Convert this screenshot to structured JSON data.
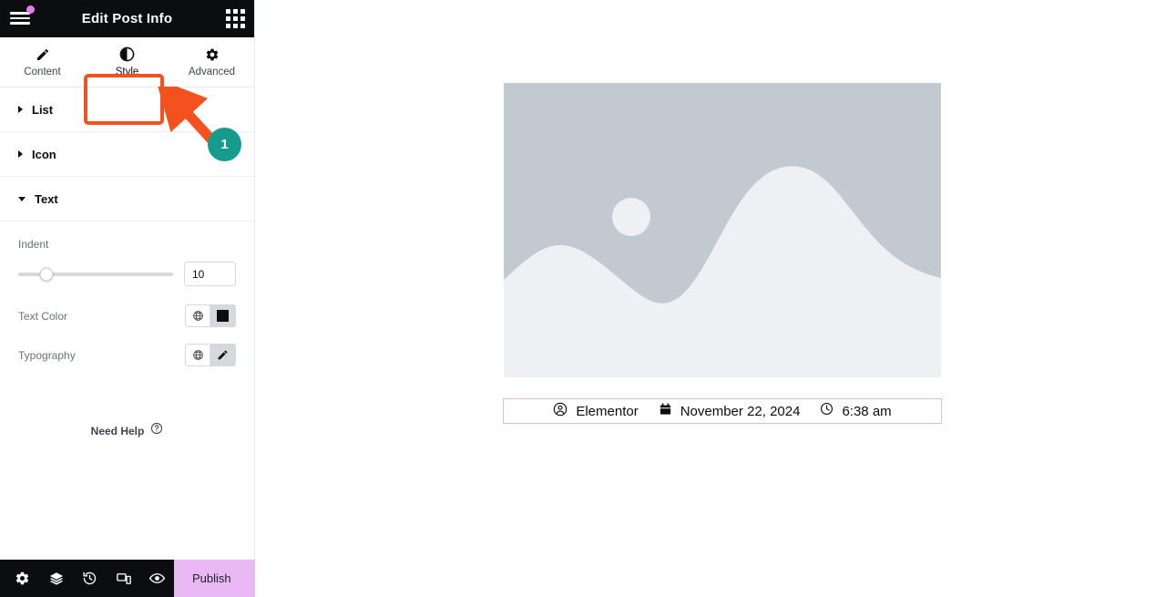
{
  "panel": {
    "header": {
      "title": "Edit Post Info",
      "menu_icon": "hamburger-menu-icon",
      "widgets_icon": "widgets-grid-icon",
      "notification_dot_color": "#e879f9"
    },
    "tabs": [
      {
        "label": "Content",
        "icon": "pencil-icon",
        "active": false
      },
      {
        "label": "Style",
        "icon": "contrast-circle-icon",
        "active": true
      },
      {
        "label": "Advanced",
        "icon": "gear-icon",
        "active": false
      }
    ],
    "sections": [
      {
        "title": "List",
        "expanded": false
      },
      {
        "title": "Icon",
        "expanded": false
      },
      {
        "title": "Text",
        "expanded": true
      }
    ],
    "text_section": {
      "indent": {
        "label": "Indent",
        "value": "10",
        "slider_percent": 18
      },
      "text_color": {
        "label": "Text Color",
        "globe_icon": "globe-icon",
        "swatch_color": "#0c0d0e"
      },
      "typography": {
        "label": "Typography",
        "globe_icon": "globe-icon",
        "edit_icon": "pencil-edit-icon"
      }
    },
    "need_help": {
      "label": "Need Help",
      "icon": "question-mark-circle-icon"
    },
    "footer": {
      "icons": [
        "settings-gear-icon",
        "navigator-layers-icon",
        "history-icon",
        "responsive-mode-icon",
        "preview-eye-icon"
      ],
      "publish_label": "Publish",
      "publish_caret_icon": "chevron-up-icon",
      "publish_bg": "#e9b8f5"
    },
    "collapse_tab_icon": "chevron-left-icon"
  },
  "annotation": {
    "badge_number": "1",
    "badge_color": "#169b8c",
    "arrow_color": "#f4511e",
    "highlight_color": "#f4511e",
    "highlight_target": "Style"
  },
  "canvas": {
    "placeholder_image": {
      "name": "elementor-placeholder-image",
      "sky_color": "#c3c9d0",
      "mountain_color": "#eef0f3",
      "sun_color": "#eef0f3"
    },
    "post_info": {
      "border_color": "#e3b6ee",
      "items": [
        {
          "icon": "author-avatar-icon",
          "text": "Elementor"
        },
        {
          "icon": "calendar-icon",
          "text": "November 22, 2024"
        },
        {
          "icon": "clock-icon",
          "text": "6:38 am"
        }
      ]
    }
  }
}
